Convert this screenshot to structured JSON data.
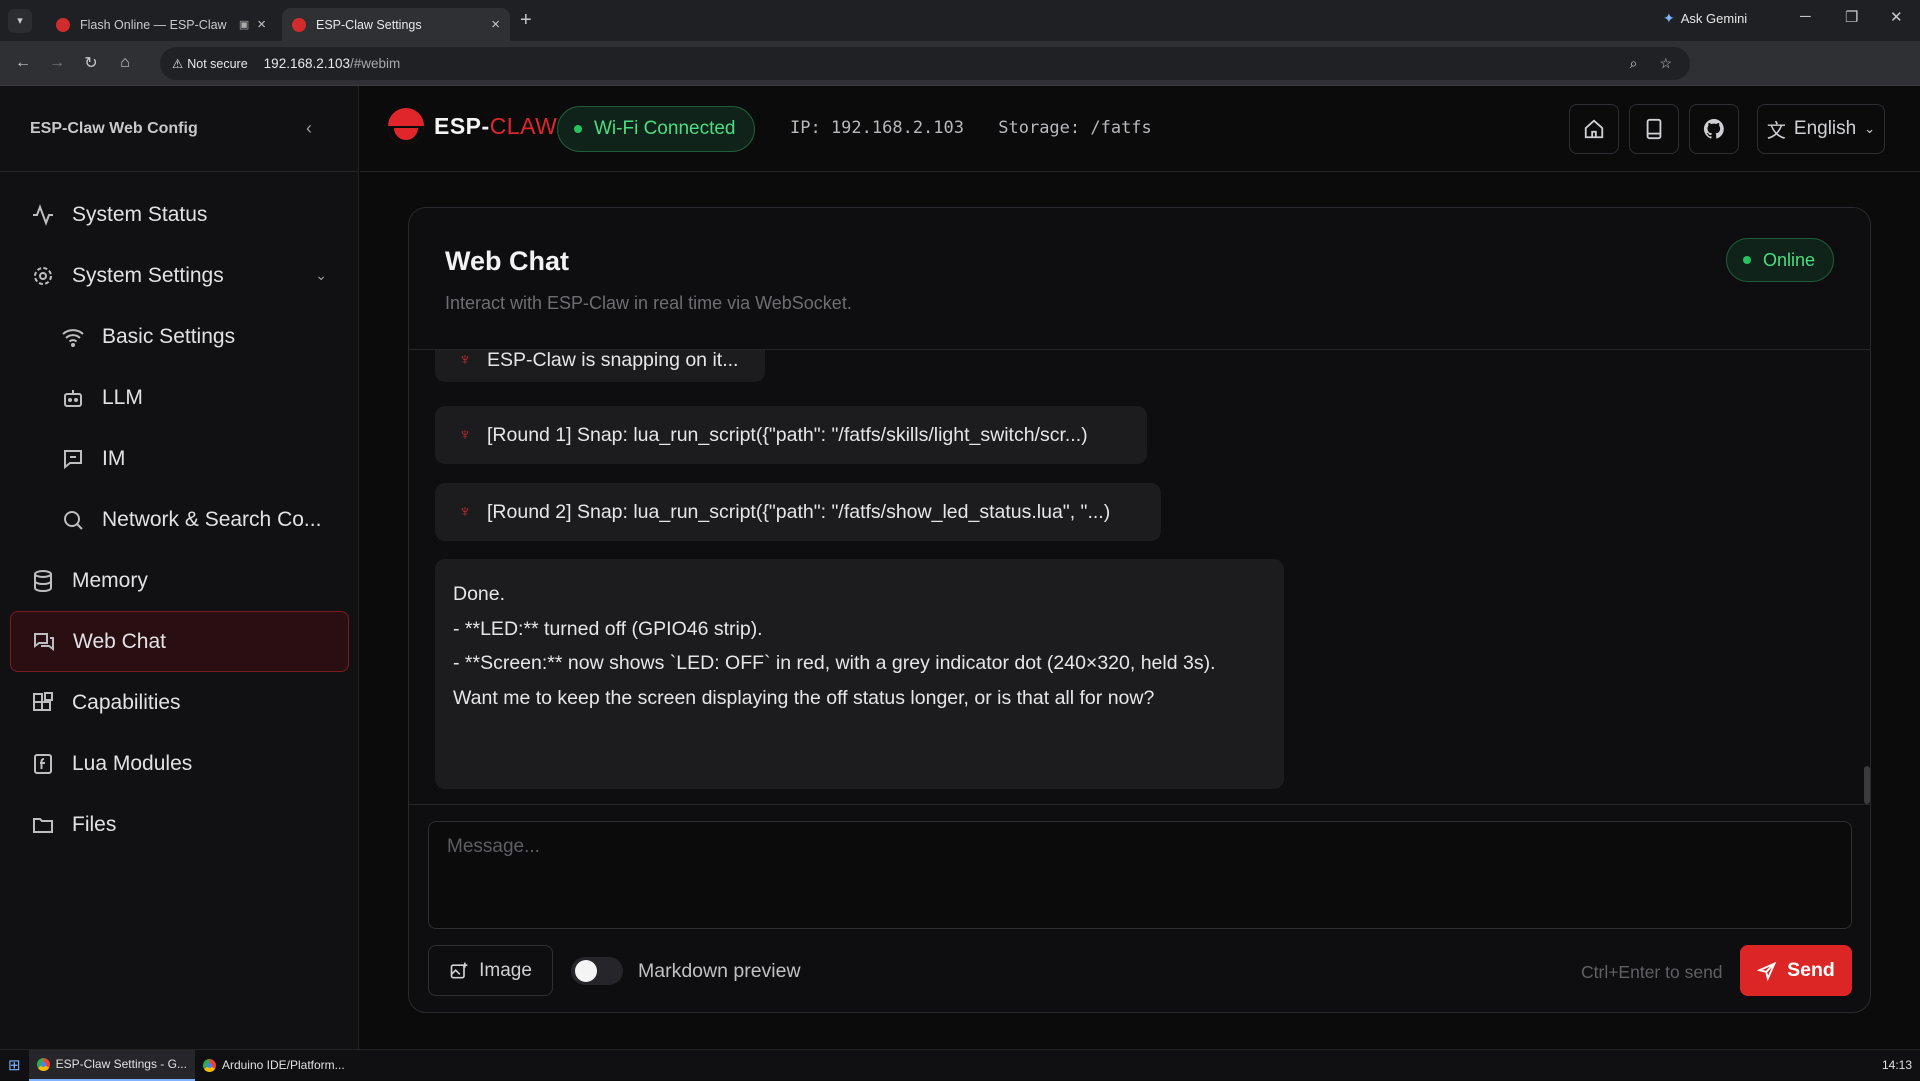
{
  "browser": {
    "tabs": [
      {
        "title": "Flash Online — ESP-Claw",
        "active": false
      },
      {
        "title": "ESP-Claw Settings",
        "active": true
      }
    ],
    "ask_gemini": "Ask Gemini",
    "security_label": "Not secure",
    "url_host": "192.168.2.103",
    "url_rest": "/#webim"
  },
  "sidebar": {
    "title": "ESP-Claw Web Config",
    "items": [
      {
        "label": "System Status",
        "icon": "activity-icon"
      },
      {
        "label": "System Settings",
        "icon": "gear-icon"
      },
      {
        "label": "Basic Settings",
        "icon": "wifi-icon"
      },
      {
        "label": "LLM",
        "icon": "bot-icon"
      },
      {
        "label": "IM",
        "icon": "message-icon"
      },
      {
        "label": "Network & Search Co...",
        "icon": "search-icon"
      },
      {
        "label": "Memory",
        "icon": "database-icon"
      },
      {
        "label": "Web Chat",
        "icon": "chat-icon",
        "active": true
      },
      {
        "label": "Capabilities",
        "icon": "blocks-icon"
      },
      {
        "label": "Lua Modules",
        "icon": "lua-file-icon"
      },
      {
        "label": "Files",
        "icon": "folder-icon"
      }
    ]
  },
  "topbar": {
    "logo_esp": "ESP-",
    "logo_claw": "CLAW",
    "wifi_status": "Wi-Fi Connected",
    "ip": "IP: 192.168.2.103",
    "storage": "Storage: /fatfs",
    "language": "English"
  },
  "chat": {
    "title": "Web Chat",
    "subtitle": "Interact with ESP-Claw in real time via WebSocket.",
    "status": "Online",
    "status_messages": [
      "ESP-Claw is snapping on it...",
      "[Round 1] Snap: lua_run_script({\"path\": \"/fatfs/skills/light_switch/scr...)",
      "[Round 2] Snap: lua_run_script({\"path\": \"/fatfs/show_led_status.lua\", \"...)"
    ],
    "reply_lines": [
      "Done.",
      "",
      "- **LED:** turned off (GPIO46 strip).",
      "- **Screen:** now shows `LED: OFF` in red, with a grey indicator dot (240×320, held 3s).",
      "",
      "Want me to keep the screen displaying the off status longer, or is that all for now?"
    ],
    "input_placeholder": "Message...",
    "image_label": "Image",
    "markdown_label": "Markdown preview",
    "markdown_on": false,
    "hint": "Ctrl+Enter to send",
    "send_label": "Send"
  },
  "taskbar": {
    "items": [
      "ESP-Claw Settings - G...",
      "Arduino IDE/Platform..."
    ],
    "clock": "14:13"
  },
  "colors": {
    "accent": "#dc2626",
    "success": "#4ade80",
    "active_nav_bg": "#2a0f12"
  }
}
